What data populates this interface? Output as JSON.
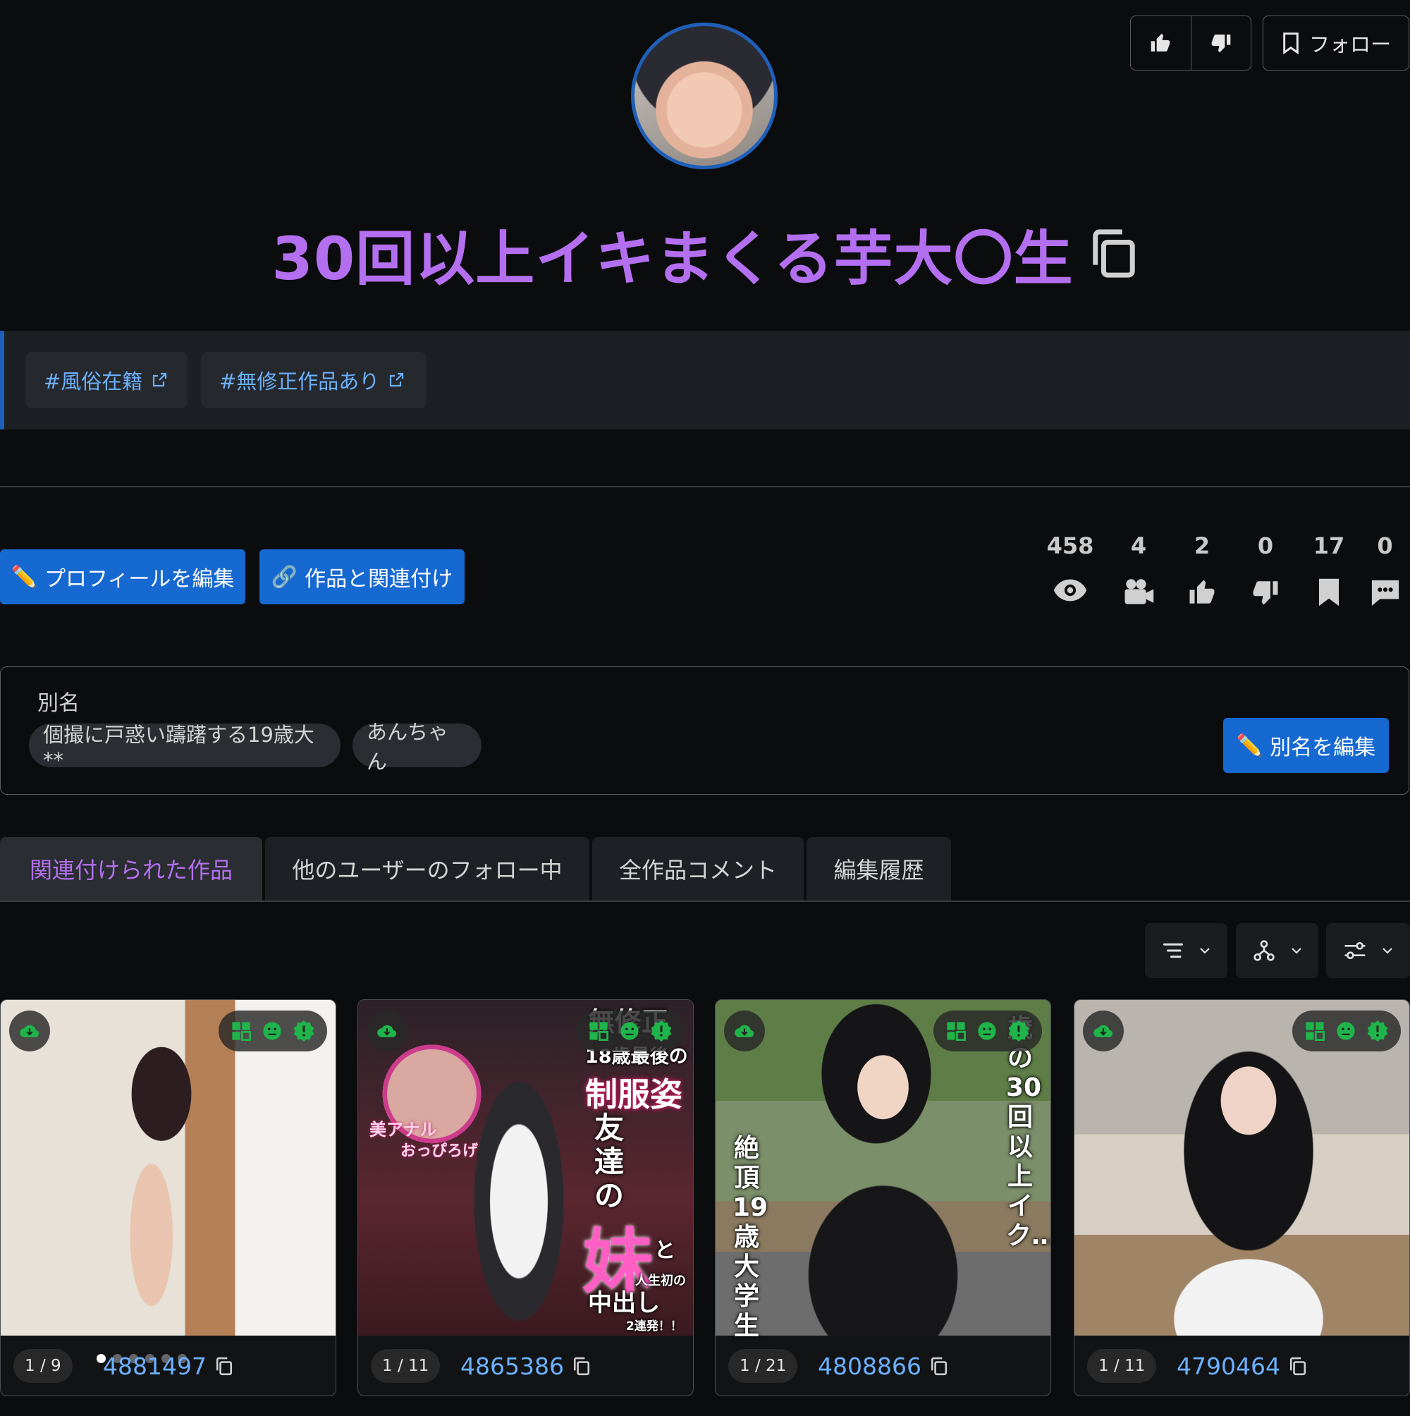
{
  "header": {
    "follow_label": "フォロー",
    "title": "30回以上イキまくる芋大〇生"
  },
  "tags": [
    {
      "label": "#風俗在籍"
    },
    {
      "label": "#無修正作品あり"
    }
  ],
  "actions": {
    "edit_profile": "プロフィールを編集",
    "link_works": "作品と関連付け"
  },
  "stats": [
    {
      "name": "views",
      "value": "458",
      "icon": "eye-icon"
    },
    {
      "name": "works",
      "value": "4",
      "icon": "video-camera-icon"
    },
    {
      "name": "likes",
      "value": "2",
      "icon": "thumbs-up-icon"
    },
    {
      "name": "dislikes",
      "value": "0",
      "icon": "thumbs-down-icon"
    },
    {
      "name": "bookmarks",
      "value": "17",
      "icon": "bookmark-icon"
    },
    {
      "name": "comments",
      "value": "0",
      "icon": "comment-icon"
    }
  ],
  "aliases": {
    "label": "別名",
    "items": [
      "個撮に戸惑い躊躇する19歳大**",
      "あんちゃん"
    ],
    "edit_label": "別名を編集"
  },
  "tabs": [
    {
      "label": "関連付けられた作品",
      "active": true
    },
    {
      "label": "他のユーザーのフォロー中",
      "active": false
    },
    {
      "label": "全作品コメント",
      "active": false
    },
    {
      "label": "編集履歴",
      "active": false
    }
  ],
  "cards": [
    {
      "id": "4881497",
      "counter": "1 / 9"
    },
    {
      "id": "4865386",
      "counter": "1 / 11",
      "overlay": {
        "top": "18歳最後の",
        "mid": "制服姿",
        "friend": "友達の",
        "sister": "妹",
        "to": "と",
        "first": "人生初の",
        "creampie": "中出し",
        "renpatsu": "2連発！！",
        "anal1": "美アナル",
        "anal2": "おっぴろげ",
        "corner": "無修正"
      }
    },
    {
      "id": "4808866",
      "counter": "1 / 21",
      "overlay": {
        "left": "絶頂19歳大学生",
        "right": "歳の30回以上イク…"
      }
    },
    {
      "id": "4790464",
      "counter": "1 / 11"
    }
  ],
  "colors": {
    "accent": "#b46ff0",
    "primary": "#1769d2",
    "link": "#6cb0ff",
    "success": "#1fb54a"
  }
}
